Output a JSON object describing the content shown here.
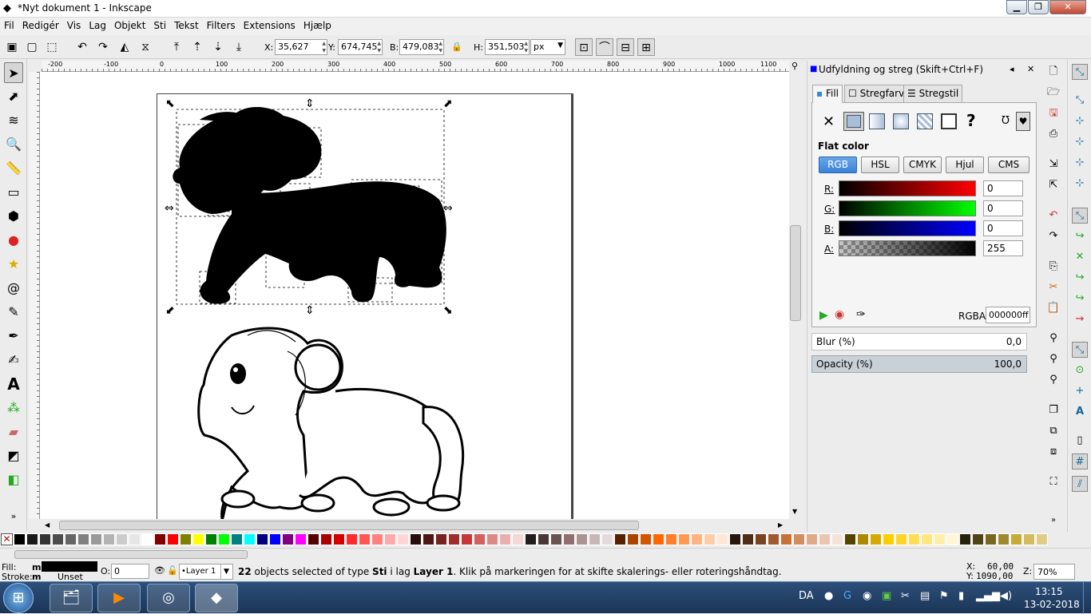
{
  "window": {
    "title": "*Nyt dokument 1 - Inkscape",
    "minimize": "▁",
    "maximize": "❐",
    "close": "✕"
  },
  "menu": [
    "Fil",
    "Redigér",
    "Vis",
    "Lag",
    "Objekt",
    "Sti",
    "Tekst",
    "Filters",
    "Extensions",
    "Hjælp"
  ],
  "toolbar": {
    "x_label": "X:",
    "x_value": "35,627",
    "y_label": "Y:",
    "y_value": "674,745",
    "w_label": "B:",
    "w_value": "479,083",
    "h_label": "H:",
    "h_value": "351,503",
    "unit": "px"
  },
  "ruler": {
    "ticks": [
      "-200",
      "-100",
      "0",
      "100",
      "200",
      "300",
      "400",
      "500",
      "600",
      "700",
      "800",
      "900",
      "1000",
      "1100"
    ]
  },
  "dock": {
    "title": "Udfyldning og streg (Skift+Ctrl+F)",
    "tabs": [
      "Fill",
      "Stregfarve",
      "Stregstil"
    ],
    "mode_label": "Flat color",
    "color_modes": [
      "RGB",
      "HSL",
      "CMYK",
      "Hjul",
      "CMS"
    ],
    "channels": [
      {
        "label": "R:",
        "value": "0"
      },
      {
        "label": "G:",
        "value": "0"
      },
      {
        "label": "B:",
        "value": "0"
      },
      {
        "label": "A:",
        "value": "255"
      }
    ],
    "rgba_label": "RGBA:",
    "rgba_value": "000000ff",
    "blur_label": "Blur (%)",
    "blur_value": "0,0",
    "opacity_label": "Opacity (%)",
    "opacity_value": "100,0"
  },
  "status": {
    "fill_label": "Fill:",
    "fill_value": "m",
    "stroke_label": "Stroke:",
    "stroke_value": "m",
    "stroke_state": "Unset",
    "opacity_label": "O:",
    "opacity_value": "0",
    "layer": "•Layer 1",
    "message_count": "22",
    "message_pre": " objects selected of type ",
    "message_type": "Sti",
    "message_mid": " i lag ",
    "message_layer": "Layer 1",
    "message_post": ". Klik på markeringen for at skifte skalerings- eller roteringshåndtag.",
    "cursor_x_label": "X:",
    "cursor_x": "60,00",
    "cursor_y_label": "Y:",
    "cursor_y": "1090,00",
    "zoom_label": "Z:",
    "zoom": "70%"
  },
  "taskbar": {
    "lang": "DA",
    "time": "13:15",
    "date": "13-02-2018"
  },
  "palette_colors": [
    "#000000",
    "#1a1a1a",
    "#333333",
    "#4d4d4d",
    "#666666",
    "#808080",
    "#999999",
    "#b3b3b3",
    "#cccccc",
    "#e6e6e6",
    "#ffffff",
    "#800000",
    "#ff0000",
    "#808000",
    "#ffff00",
    "#008000",
    "#00ff00",
    "#008080",
    "#00ffff",
    "#000080",
    "#0000ff",
    "#800080",
    "#ff00ff",
    "#550000",
    "#aa0000",
    "#d40000",
    "#ff2a2a",
    "#ff5555",
    "#ff8080",
    "#ffaaaa",
    "#ffd5d5",
    "#280b0b",
    "#501616",
    "#782121",
    "#a02c2c",
    "#c83737",
    "#d35f5f",
    "#de8787",
    "#e9afaf",
    "#f4d7d7",
    "#241c1c",
    "#483737",
    "#6c5353",
    "#916f6f",
    "#ac9393",
    "#c8b7b7",
    "#e3dbdb",
    "#552200",
    "#aa4400",
    "#d45500",
    "#ff6600",
    "#ff7f2a",
    "#ff9955",
    "#ffb380",
    "#ffccaa",
    "#ffe6d5",
    "#28170b",
    "#502d16",
    "#784421",
    "#a05a2c",
    "#c87137",
    "#d38d5f",
    "#deaa87",
    "#e9c6af",
    "#f4e3d7",
    "#554400",
    "#aa8800",
    "#d4aa00",
    "#ffcc00",
    "#ffd42a",
    "#ffdd55",
    "#ffe680",
    "#ffeeaa",
    "#fff6d5",
    "#28220b",
    "#504416",
    "#786721",
    "#a0892c",
    "#c8ab37",
    "#d3bc5f",
    "#decd87"
  ],
  "colors": {
    "accent": "#3b82d8",
    "selection": "#000000"
  }
}
